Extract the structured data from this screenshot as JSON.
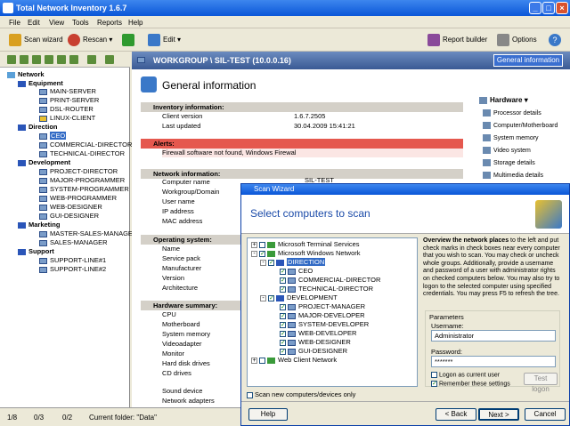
{
  "window": {
    "title": "Total Network Inventory 1.6.7"
  },
  "menu": [
    "File",
    "Edit",
    "View",
    "Tools",
    "Reports",
    "Help"
  ],
  "toolbar": {
    "scan_wizard": "Scan wizard",
    "rescan": "Rescan",
    "edit": "Edit",
    "report_builder": "Report builder",
    "options": "Options"
  },
  "tree": {
    "network": "Network",
    "equipment": "Equipment",
    "equipment_items": [
      "MAIN-SERVER",
      "PRINT-SERVER",
      "DSL-ROUTER",
      "LINUX-CLIENT"
    ],
    "direction": "Direction",
    "direction_items": [
      "CEO",
      "COMMERCIAL-DIRECTOR",
      "TECHNICAL-DIRECTOR"
    ],
    "development": "Development",
    "development_items": [
      "PROJECT-DIRECTOR",
      "MAJOR-PROGRAMMER",
      "SYSTEM-PROGRAMMER",
      "WEB-PROGRAMMER",
      "WEB-DESIGNER",
      "GUI-DESIGNER"
    ],
    "marketing": "Marketing",
    "marketing_items": [
      "MASTER-SALES-MANAGER",
      "SALES-MANAGER"
    ],
    "support": "Support",
    "support_items": [
      "SUPPORT-LINE#1",
      "SUPPORT-LINE#2"
    ]
  },
  "address": "WORKGROUP \\ SIL-TEST (10.0.0.16)",
  "general_info_button": "General information",
  "main": {
    "title": "General information",
    "inventory_header": "Inventory information:",
    "client_version_label": "Client version",
    "client_version": "1.6.7.2505",
    "last_updated_label": "Last updated",
    "last_updated": "30.04.2009 15:41:21",
    "alerts_header": "Alerts:",
    "alert_text": "Firewall software not found, Windows Firewal",
    "network_header": "Network information:",
    "network_rows": [
      "Computer name",
      "Workgroup/Domain",
      "User name",
      "IP address",
      "MAC address"
    ],
    "computer_name": "SIL-TEST",
    "os_header": "Operating system:",
    "os_rows": [
      "Name",
      "Service pack",
      "Manufacturer",
      "Version",
      "Architecture"
    ],
    "hw_header": "Hardware summary:",
    "hw_rows": [
      "CPU",
      "Motherboard",
      "System memory",
      "Videoadapter",
      "Monitor",
      "Hard disk drives",
      "CD drives",
      "",
      "Sound device",
      "Network adapters"
    ]
  },
  "hardware_menu": {
    "title": "Hardware",
    "items": [
      "Processor details",
      "Computer/Motherboard",
      "System memory",
      "Video system",
      "Storage details",
      "Multimedia details"
    ]
  },
  "status": {
    "c1": "1/8",
    "c2": "0/3",
    "c3": "0/2",
    "folder": "Current folder: \"Data\""
  },
  "dialog": {
    "title": "Scan Wizard",
    "heading": "Select computers to scan",
    "tree": {
      "terminal": "Microsoft Terminal Services",
      "windows_network": "Microsoft Windows Network",
      "direction": "DIRECTION",
      "direction_items": [
        "CEO",
        "COMMERCIAL-DIRECTOR",
        "TECHNICAL-DIRECTOR"
      ],
      "development": "DEVELOPMENT",
      "development_items": [
        "PROJECT-MANAGER",
        "MAJOR-DEVELOPER",
        "SYSTEM-DEVELOPER",
        "WEB-DEVELOPER",
        "WEB-DESIGNER",
        "GUI-DESIGNER"
      ],
      "web_client": "Web Client Network"
    },
    "desc_bold": "Overview the network places",
    "desc_rest": " to the left and put check marks in check boxes near every computer that you wish to scan. You may check or uncheck whole groups. Additionally, provide a username and password of a user with administrator rights on checked computers below. You may also try to logon to the selected computer using specified credentials. You may press F5 to refresh the tree.",
    "params_label": "Parameters",
    "username_label": "Username:",
    "username": "Administrator",
    "password_label": "Password:",
    "password": "*******",
    "logon_current": "Logon as current user",
    "remember": "Remember these settings",
    "test_logon": "Test logon",
    "scan_new": "Scan new computers/devices only",
    "help": "Help",
    "back": "< Back",
    "next": "Next >",
    "cancel": "Cancel"
  }
}
